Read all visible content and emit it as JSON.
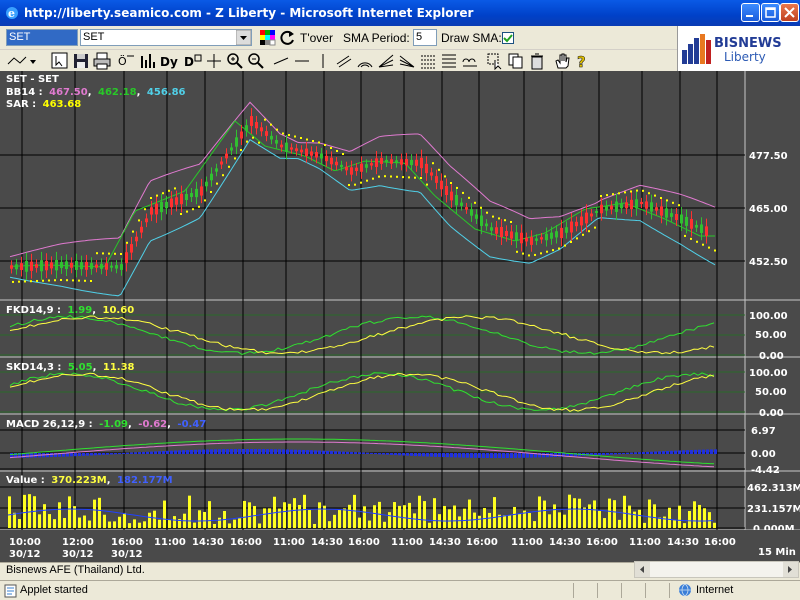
{
  "window": {
    "title": "http://liberty.seamico.com - Z Liberty - Microsoft Internet Explorer"
  },
  "toolbar": {
    "symbol_input": "SET",
    "symbol_select": "SET",
    "tover_label": "T'over",
    "sma_period_label": "SMA Period:",
    "sma_period_value": "5",
    "draw_sma_label": "Draw SMA:",
    "draw_sma_checked": true
  },
  "logo": {
    "line1": "BISNEWS",
    "line2": "Liberty"
  },
  "chart_data": [
    {
      "panel": "price",
      "type": "candlestick",
      "header": {
        "title": "SET - SET",
        "bb_label": "BB14 :",
        "bb_upper": "467.50",
        "bb_middle": "462.18",
        "bb_lower": "456.86",
        "sar_label": "SAR :",
        "sar_value": "463.68"
      },
      "y_ticks": [
        "477.50",
        "465.00",
        "452.50"
      ],
      "ylim": [
        446,
        484
      ],
      "series_colors": {
        "bb_upper": "#e07ad0",
        "bb_middle": "#28c828",
        "bb_lower": "#50d0e8",
        "sar": "#ffff00",
        "up": "#30c030",
        "down": "#ff3030"
      }
    },
    {
      "panel": "fastk",
      "type": "line",
      "label": "FKD14,9 :",
      "values": [
        "1.99",
        "10.60"
      ],
      "y_ticks": [
        "100.00",
        "50.00",
        "0.00"
      ],
      "ylim": [
        0,
        100
      ]
    },
    {
      "panel": "slowk",
      "type": "line",
      "label": "SKD14,3 :",
      "values": [
        "5.05",
        "11.38"
      ],
      "y_ticks": [
        "100.00",
        "50.00",
        "0.00"
      ],
      "ylim": [
        0,
        100
      ]
    },
    {
      "panel": "macd",
      "type": "line",
      "label": "MACD 26,12,9 :",
      "values": [
        "-1.09",
        "-0.62",
        "-0.47"
      ],
      "y_ticks": [
        "6.97",
        "0.00",
        "-4.42"
      ],
      "ylim": [
        -4.42,
        6.97
      ]
    },
    {
      "panel": "volume",
      "type": "bar",
      "label": "Value :",
      "values": [
        "370.223M",
        "182.177M"
      ],
      "y_ticks": [
        "462.313M",
        "231.157M",
        "0.000M"
      ],
      "ylim": [
        0,
        462.313
      ]
    }
  ],
  "x_axis": {
    "ticks": [
      {
        "time": "10:00",
        "date": "30/12"
      },
      {
        "time": "12:00",
        "date": "30/12"
      },
      {
        "time": "16:00",
        "date": "30/12"
      },
      {
        "time": "11:00",
        "date": ""
      },
      {
        "time": "14:30",
        "date": ""
      },
      {
        "time": "16:00",
        "date": ""
      },
      {
        "time": "11:00",
        "date": ""
      },
      {
        "time": "14:30",
        "date": ""
      },
      {
        "time": "16:00",
        "date": ""
      },
      {
        "time": "11:00",
        "date": ""
      },
      {
        "time": "14:30",
        "date": ""
      },
      {
        "time": "16:00",
        "date": ""
      },
      {
        "time": "11:00",
        "date": ""
      },
      {
        "time": "14:30",
        "date": ""
      },
      {
        "time": "16:00",
        "date": ""
      },
      {
        "time": "11:00",
        "date": ""
      },
      {
        "time": "14:30",
        "date": ""
      },
      {
        "time": "16:00",
        "date": ""
      }
    ],
    "interval": "15 Min"
  },
  "footer": {
    "credit": "Bisnews AFE (Thailand) Ltd."
  },
  "statusbar": {
    "left": "Applet started",
    "zone": "Internet"
  }
}
